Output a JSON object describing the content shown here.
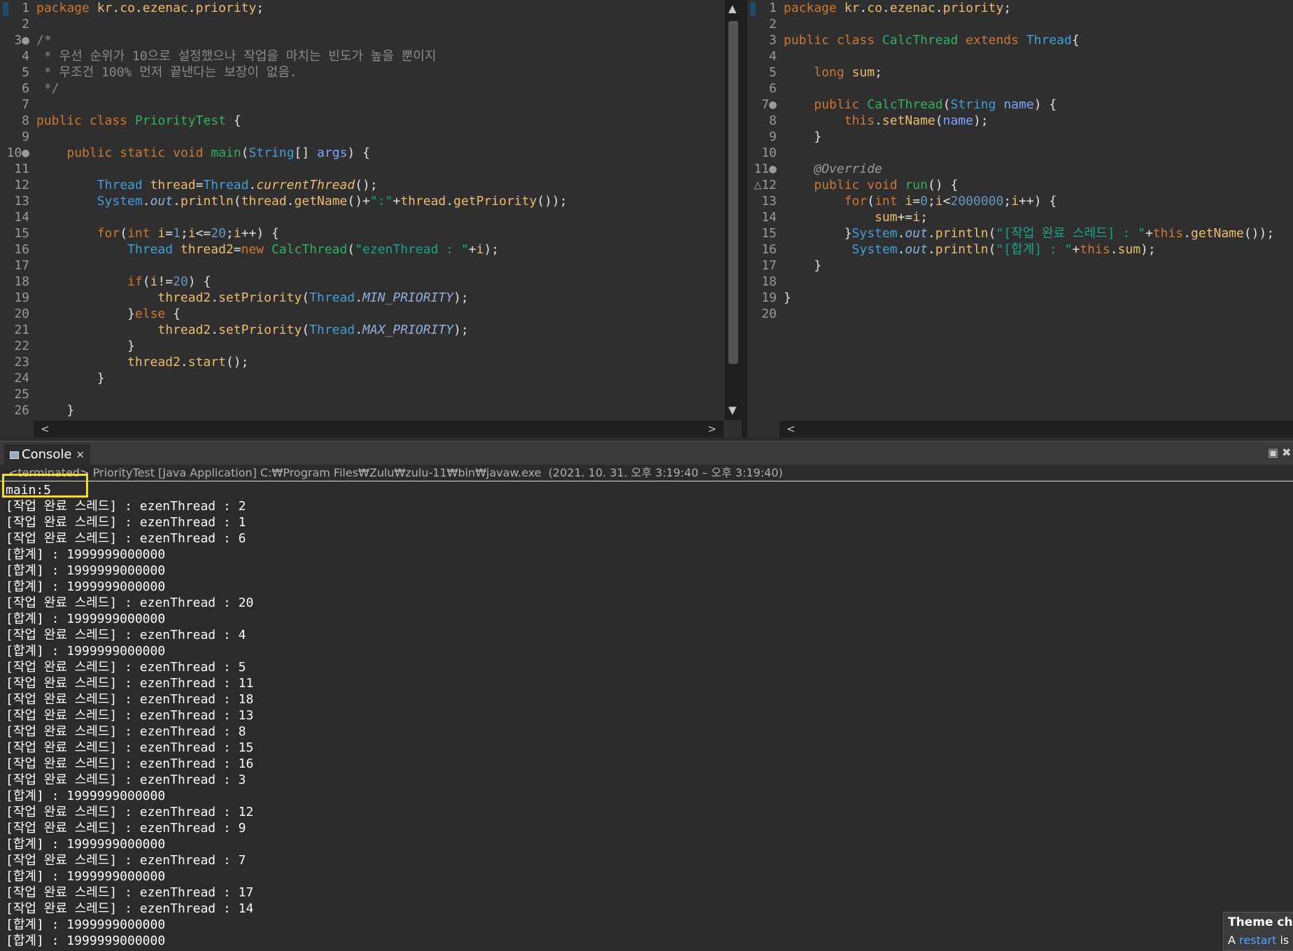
{
  "left_editor": {
    "lines": [
      {
        "n": "1",
        "t": "package kr.co.ezenac.priority;"
      },
      {
        "n": "2",
        "t": ""
      },
      {
        "n": "3●",
        "t": "/*"
      },
      {
        "n": "4",
        "t": " * 우선 순위가 10으로 설정했으나 작업을 마치는 빈도가 높을 뿐이지"
      },
      {
        "n": "5",
        "t": " * 무조건 100% 먼저 끝낸다는 보장이 없음."
      },
      {
        "n": "6",
        "t": " */"
      },
      {
        "n": "7",
        "t": ""
      },
      {
        "n": "8",
        "t": "public class PriorityTest {"
      },
      {
        "n": "9",
        "t": ""
      },
      {
        "n": "10●",
        "t": "    public static void main(String[] args) {"
      },
      {
        "n": "11",
        "t": ""
      },
      {
        "n": "12",
        "t": "        Thread thread=Thread.currentThread();"
      },
      {
        "n": "13",
        "t": "        System.out.println(thread.getName()+\":\"+thread.getPriority());"
      },
      {
        "n": "14",
        "t": ""
      },
      {
        "n": "15",
        "t": "        for(int i=1;i<=20;i++) {"
      },
      {
        "n": "16",
        "t": "            Thread thread2=new CalcThread(\"ezenThread : \"+i);"
      },
      {
        "n": "17",
        "t": ""
      },
      {
        "n": "18",
        "t": "            if(i!=20) {"
      },
      {
        "n": "19",
        "t": "                thread2.setPriority(Thread.MIN_PRIORITY);"
      },
      {
        "n": "20",
        "t": "            }else {"
      },
      {
        "n": "21",
        "t": "                thread2.setPriority(Thread.MAX_PRIORITY);"
      },
      {
        "n": "22",
        "t": "            }"
      },
      {
        "n": "23",
        "t": "            thread2.start();"
      },
      {
        "n": "24",
        "t": "        }"
      },
      {
        "n": "25",
        "t": ""
      },
      {
        "n": "26",
        "t": "    }"
      }
    ]
  },
  "right_editor": {
    "lines": [
      {
        "n": "1",
        "t": "package kr.co.ezenac.priority;"
      },
      {
        "n": "2",
        "t": ""
      },
      {
        "n": "3",
        "t": "public class CalcThread extends Thread{"
      },
      {
        "n": "4",
        "t": ""
      },
      {
        "n": "5",
        "t": "    long sum;"
      },
      {
        "n": "6",
        "t": ""
      },
      {
        "n": "7●",
        "t": "    public CalcThread(String name) {"
      },
      {
        "n": "8",
        "t": "        this.setName(name);"
      },
      {
        "n": "9",
        "t": "    }"
      },
      {
        "n": "10",
        "t": ""
      },
      {
        "n": "11●",
        "t": "    @Override"
      },
      {
        "n": "△12",
        "t": "    public void run() {"
      },
      {
        "n": "13",
        "t": "        for(int i=0;i<2000000;i++) {"
      },
      {
        "n": "14",
        "t": "            sum+=i;"
      },
      {
        "n": "15",
        "t": "        }System.out.println(\"[작업 완료 스레드] : \"+this.getName());"
      },
      {
        "n": "16",
        "t": "         System.out.println(\"[합계] : \"+this.sum);"
      },
      {
        "n": "17",
        "t": "    }"
      },
      {
        "n": "18",
        "t": ""
      },
      {
        "n": "19",
        "t": "}"
      },
      {
        "n": "20",
        "t": ""
      }
    ]
  },
  "console": {
    "tab_label": "Console",
    "tab_close": "✕",
    "minimize": "▣",
    "close": "✖",
    "status": "<terminated> PriorityTest [Java Application] C:₩Program Files₩Zulu₩zulu-11₩bin₩javaw.exe  (2021. 10. 31. 오후 3:19:40 – 오후 3:19:40)",
    "output": [
      "main:5",
      "[작업 완료 스레드] : ezenThread : 2",
      "[작업 완료 스레드] : ezenThread : 1",
      "[작업 완료 스레드] : ezenThread : 6",
      "[합계] : 1999999000000",
      "[합계] : 1999999000000",
      "[합계] : 1999999000000",
      "[작업 완료 스레드] : ezenThread : 20",
      "[합계] : 1999999000000",
      "[작업 완료 스레드] : ezenThread : 4",
      "[합계] : 1999999000000",
      "[작업 완료 스레드] : ezenThread : 5",
      "[작업 완료 스레드] : ezenThread : 11",
      "[작업 완료 스레드] : ezenThread : 18",
      "[작업 완료 스레드] : ezenThread : 13",
      "[작업 완료 스레드] : ezenThread : 8",
      "[작업 완료 스레드] : ezenThread : 15",
      "[작업 완료 스레드] : ezenThread : 16",
      "[작업 완료 스레드] : ezenThread : 3",
      "[합계] : 1999999000000",
      "[작업 완료 스레드] : ezenThread : 12",
      "[작업 완료 스레드] : ezenThread : 9",
      "[합계] : 1999999000000",
      "[작업 완료 스레드] : ezenThread : 7",
      "[합계] : 1999999000000",
      "[작업 완료 스레드] : ezenThread : 17",
      "[작업 완료 스레드] : ezenThread : 14",
      "[합계] : 1999999000000",
      "[합계] : 1999999000000"
    ]
  },
  "toast": {
    "title": "Theme cha",
    "text_prefix": "A ",
    "link": "restart",
    "text_suffix": " is r"
  },
  "icons": {
    "scroll_up": "▲",
    "scroll_down": "▼",
    "scroll_left": "<",
    "scroll_right": ">"
  }
}
